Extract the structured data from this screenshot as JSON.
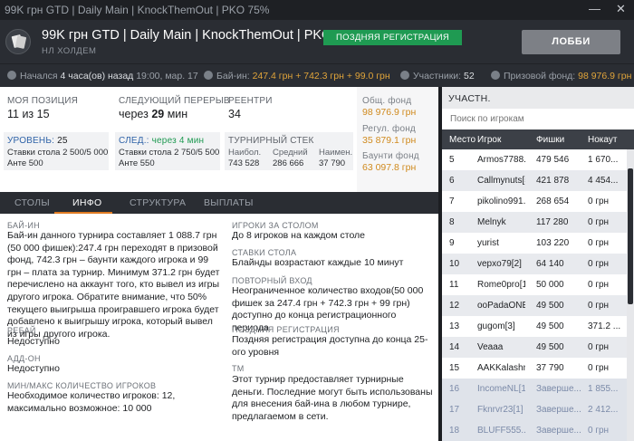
{
  "window": {
    "title": "99K грн GTD | Daily Main | KnockThemOut | PKO 75%",
    "minimize": "—",
    "close": "✕"
  },
  "header": {
    "title": "99K грн GTD | Daily Main | KnockThemOut | PKO 75%",
    "subtitle": "НЛ ХОЛДЕМ",
    "late_badge": "ПОЗДНЯЯ РЕГИСТРАЦИЯ",
    "lobby_button": "ЛОББИ"
  },
  "infobar": {
    "started_label": "Начался",
    "started_value": "4 часа(ов) назад",
    "started_time": "19:00, мар. 17",
    "buyin_label": "Бай-ин:",
    "buyin_value": "247.4 грн + 742.3 грн + 99.0 грн",
    "players_label": "Участники:",
    "players_value": "52",
    "prize_label": "Призовой фонд:",
    "prize_value": "98 976.9 грн"
  },
  "stats": {
    "my_position_label": "МОЯ ПОЗИЦИЯ",
    "my_position_value": "11 из 15",
    "next_break_label": "СЛЕДУЮЩИЙ ПЕРЕРЫВ",
    "next_break_prefix": "через",
    "next_break_value": "29",
    "next_break_unit": "мин",
    "reentry_label": "РЕЕНТРИ",
    "reentry_value": "34",
    "level_label": "УРОВЕНЬ:",
    "level_value": "25",
    "level_blinds": "Ставки стола 2 500/5 000",
    "level_ante": "Анте 500",
    "next_label": "СЛЕД.:",
    "next_time": "через 4 мин",
    "next_blinds": "Ставки стола 2 750/5 500",
    "next_ante": "Анте 550",
    "stack_label": "ТУРНИРНЫЙ СТЕК",
    "stack_max_label": "Наибол.",
    "stack_max_value": "743 528",
    "stack_avg_label": "Средний",
    "stack_avg_value": "286 666",
    "stack_min_label": "Наимен.",
    "stack_min_value": "37 790"
  },
  "prize": {
    "total_label": "Общ. фонд",
    "total_value": "98 976.9 грн",
    "regular_label": "Регул. фонд",
    "regular_value": "35 879.1 грн",
    "bounty_label": "Баунти фонд",
    "bounty_value": "63 097.8 грн"
  },
  "tabs": [
    "СТОЛЫ",
    "ИНФО",
    "СТРУКТУРА",
    "ВЫПЛАТЫ"
  ],
  "info": {
    "buyin_title": "БАЙ-ИН",
    "buyin_text": "Бай-ин данного турнира составляет 1 088.7 грн (50 000 фишек):247.4 грн переходят в призовой фонд, 742.3 грн – баунти каждого игрока и 99 грн – плата за турнир. Минимум 371.2 грн будет перечислено на аккаунт того, кто вывел из игры другого игрока. Обратите внимание, что 50% текущего выигрыша проигравшего игрока будет добавлено к выигрышу игрока, который вывел из игры другого игрока.",
    "rebuy_title": "РЕБАЙ",
    "rebuy_text": "Недоступно",
    "addon_title": "АДД-ОН",
    "addon_text": "Недоступно",
    "minmax_title": "МИН/МАКС КОЛИЧЕСТВО ИГРОКОВ",
    "minmax_text": "Необходимое количество игроков: 12, максимально возможное: 10 000",
    "table_players_title": "ИГРОКИ ЗА СТОЛОМ",
    "table_players_text": "До 8 игроков на каждом столе",
    "stakes_title": "СТАВКИ СТОЛА",
    "stakes_text": "Блайнды возрастают каждые 10 минут",
    "reentry_title": "ПОВТОРНЫЙ ВХОД",
    "reentry_text": "Неограниченное количество входов(50 000 фишек за 247.4 грн + 742.3 грн + 99 грн) доступно до конца регистрационного периода",
    "late_title": "ПОЗДНЯЯ РЕГИСТРАЦИЯ",
    "late_text": "Поздняя регистрация доступна до конца 25-ого уровня",
    "tm_title": "ТМ",
    "tm_text": "Этот турнир предоставляет турнирные деньги. Последние могут быть использованы для внесения бай-ина в любом турнире, предлагаемом в сети."
  },
  "sidebar": {
    "header": "УЧАСТН.",
    "search_placeholder": "Поиск по игрокам",
    "columns": [
      "Место",
      "Игрок",
      "Фишки",
      "Нокаут"
    ],
    "rows": [
      {
        "place": "5",
        "player": "Armos7788...",
        "chips": "479 546",
        "ko": "1 670..."
      },
      {
        "place": "6",
        "player": "Callmynuts[5]",
        "chips": "421 878",
        "ko": "4 454..."
      },
      {
        "place": "7",
        "player": "pikolino991...",
        "chips": "268 654",
        "ko": "0 грн"
      },
      {
        "place": "8",
        "player": "Melnyk",
        "chips": "117 280",
        "ko": "0 грн"
      },
      {
        "place": "9",
        "player": "yurist",
        "chips": "103 220",
        "ko": "0 грн"
      },
      {
        "place": "10",
        "player": "vepxo79[2]",
        "chips": "64 140",
        "ko": "0 грн"
      },
      {
        "place": "11",
        "player": "Rome0pro[1]",
        "chips": "50 000",
        "ko": "0 грн"
      },
      {
        "place": "12",
        "player": "ooPadaONE...",
        "chips": "49 500",
        "ko": "0 грн"
      },
      {
        "place": "13",
        "player": "gugom[3]",
        "chips": "49 500",
        "ko": "371.2 ..."
      },
      {
        "place": "14",
        "player": "Veaaa",
        "chips": "49 500",
        "ko": "0 грн"
      },
      {
        "place": "15",
        "player": "AAKKalashn...",
        "chips": "37 790",
        "ko": "0 грн"
      },
      {
        "place": "16",
        "player": "IncomeNL[1]",
        "chips": "Заверше...",
        "ko": "1 855..."
      },
      {
        "place": "17",
        "player": "Fknrvr23[1]",
        "chips": "Заверше...",
        "ko": "2 412..."
      },
      {
        "place": "18",
        "player": "BLUFF555...",
        "chips": "Заверше...",
        "ko": "0 грн"
      }
    ]
  },
  "colors": {
    "accent_green": "#1f9a52",
    "prize_gold": "#d08a1e",
    "tab_underline": "#e07b22",
    "header_bg": "#2a2d33"
  }
}
